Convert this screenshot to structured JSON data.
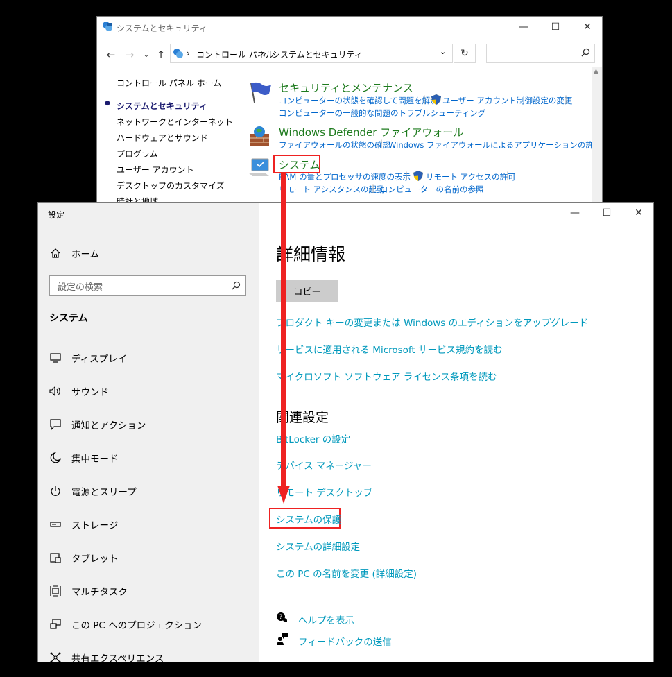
{
  "control_panel": {
    "title": "システムとセキュリティ",
    "breadcrumb": [
      "コントロール パネル",
      "システムとセキュリティ"
    ],
    "sidebar": {
      "home": "コントロール パネル ホーム",
      "items": [
        "システムとセキュリティ",
        "ネットワークとインターネット",
        "ハードウェアとサウンド",
        "プログラム",
        "ユーザー アカウント",
        "デスクトップのカスタマイズ",
        "時計と地域"
      ],
      "selected_index": 0
    },
    "sections": [
      {
        "heading": "セキュリティとメンテナンス",
        "links_row1": [
          "コンピューターの状態を確認して問題を解決",
          "ユーザー アカウント制御設定の変更"
        ],
        "links_row2": [
          "コンピューターの一般的な問題のトラブルシューティング"
        ]
      },
      {
        "heading": "Windows Defender ファイアウォール",
        "links_row1": [
          "ファイアウォールの状態の確認",
          "Windows ファイアウォールによるアプリケーションの許可"
        ]
      },
      {
        "heading": "システム",
        "links_row1": [
          "RAM の量とプロセッサの速度の表示",
          "リモート アクセスの許可"
        ],
        "links_row2": [
          "リモート アシスタンスの起動",
          "コンピューターの名前の参照"
        ]
      }
    ]
  },
  "settings": {
    "title": "設定",
    "home_label": "ホーム",
    "search_placeholder": "設定の検索",
    "section_label": "システム",
    "nav": [
      {
        "label": "ディスプレイ",
        "icon": "display-icon"
      },
      {
        "label": "サウンド",
        "icon": "sound-icon"
      },
      {
        "label": "通知とアクション",
        "icon": "notification-icon"
      },
      {
        "label": "集中モード",
        "icon": "moon-icon"
      },
      {
        "label": "電源とスリープ",
        "icon": "power-icon"
      },
      {
        "label": "ストレージ",
        "icon": "storage-icon"
      },
      {
        "label": "タブレット",
        "icon": "tablet-icon"
      },
      {
        "label": "マルチタスク",
        "icon": "multitask-icon"
      },
      {
        "label": "この PC へのプロジェクション",
        "icon": "projection-icon"
      },
      {
        "label": "共有エクスペリエンス",
        "icon": "share-icon"
      }
    ],
    "page_title": "詳細情報",
    "copy_button": "コピー",
    "links": [
      "プロダクト キーの変更または Windows のエディションをアップグレード",
      "サービスに適用される Microsoft サービス規約を読む",
      "マイクロソフト ソフトウェア ライセンス条項を読む"
    ],
    "related_title": "関連設定",
    "related_links": [
      "BitLocker の設定",
      "デバイス マネージャー",
      "リモート デスクトップ",
      "システムの保護",
      "システムの詳細設定",
      "この PC の名前を変更 (詳細設定)"
    ],
    "help": "ヘルプを表示",
    "feedback": "フィードバックの送信"
  },
  "colors": {
    "accent_link": "#0099bc",
    "cp_link": "#0066cc",
    "cp_heading": "#1e7b1e",
    "highlight": "#e22222"
  }
}
